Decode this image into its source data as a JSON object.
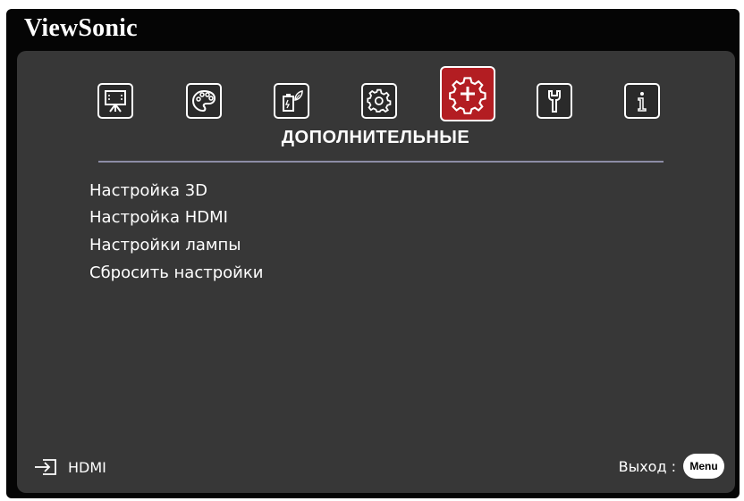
{
  "brand": {
    "name": "ViewSonic"
  },
  "tabs": [
    {
      "icon": "display-icon",
      "active": false
    },
    {
      "icon": "palette-icon",
      "active": false
    },
    {
      "icon": "power-leaf-icon",
      "active": false
    },
    {
      "icon": "gear-icon",
      "active": false
    },
    {
      "icon": "advanced-gear-plus-icon",
      "active": true
    },
    {
      "icon": "wrench-icon",
      "active": false
    },
    {
      "icon": "info-icon",
      "active": false
    }
  ],
  "active_tab": {
    "title": "ДОПОЛНИТЕЛЬНЫЕ"
  },
  "menu": {
    "items": [
      {
        "label": "Настройка 3D"
      },
      {
        "label": "Настройка HDMI"
      },
      {
        "label": "Настройки лампы"
      },
      {
        "label": "Сбросить настройки"
      }
    ]
  },
  "footer": {
    "source_label": "HDMI",
    "exit_label": "Выход :",
    "menu_button_label": "Menu"
  },
  "colors": {
    "active_tab": "#b31d22",
    "panel": "#373737",
    "divider": "#8c8ca6"
  }
}
